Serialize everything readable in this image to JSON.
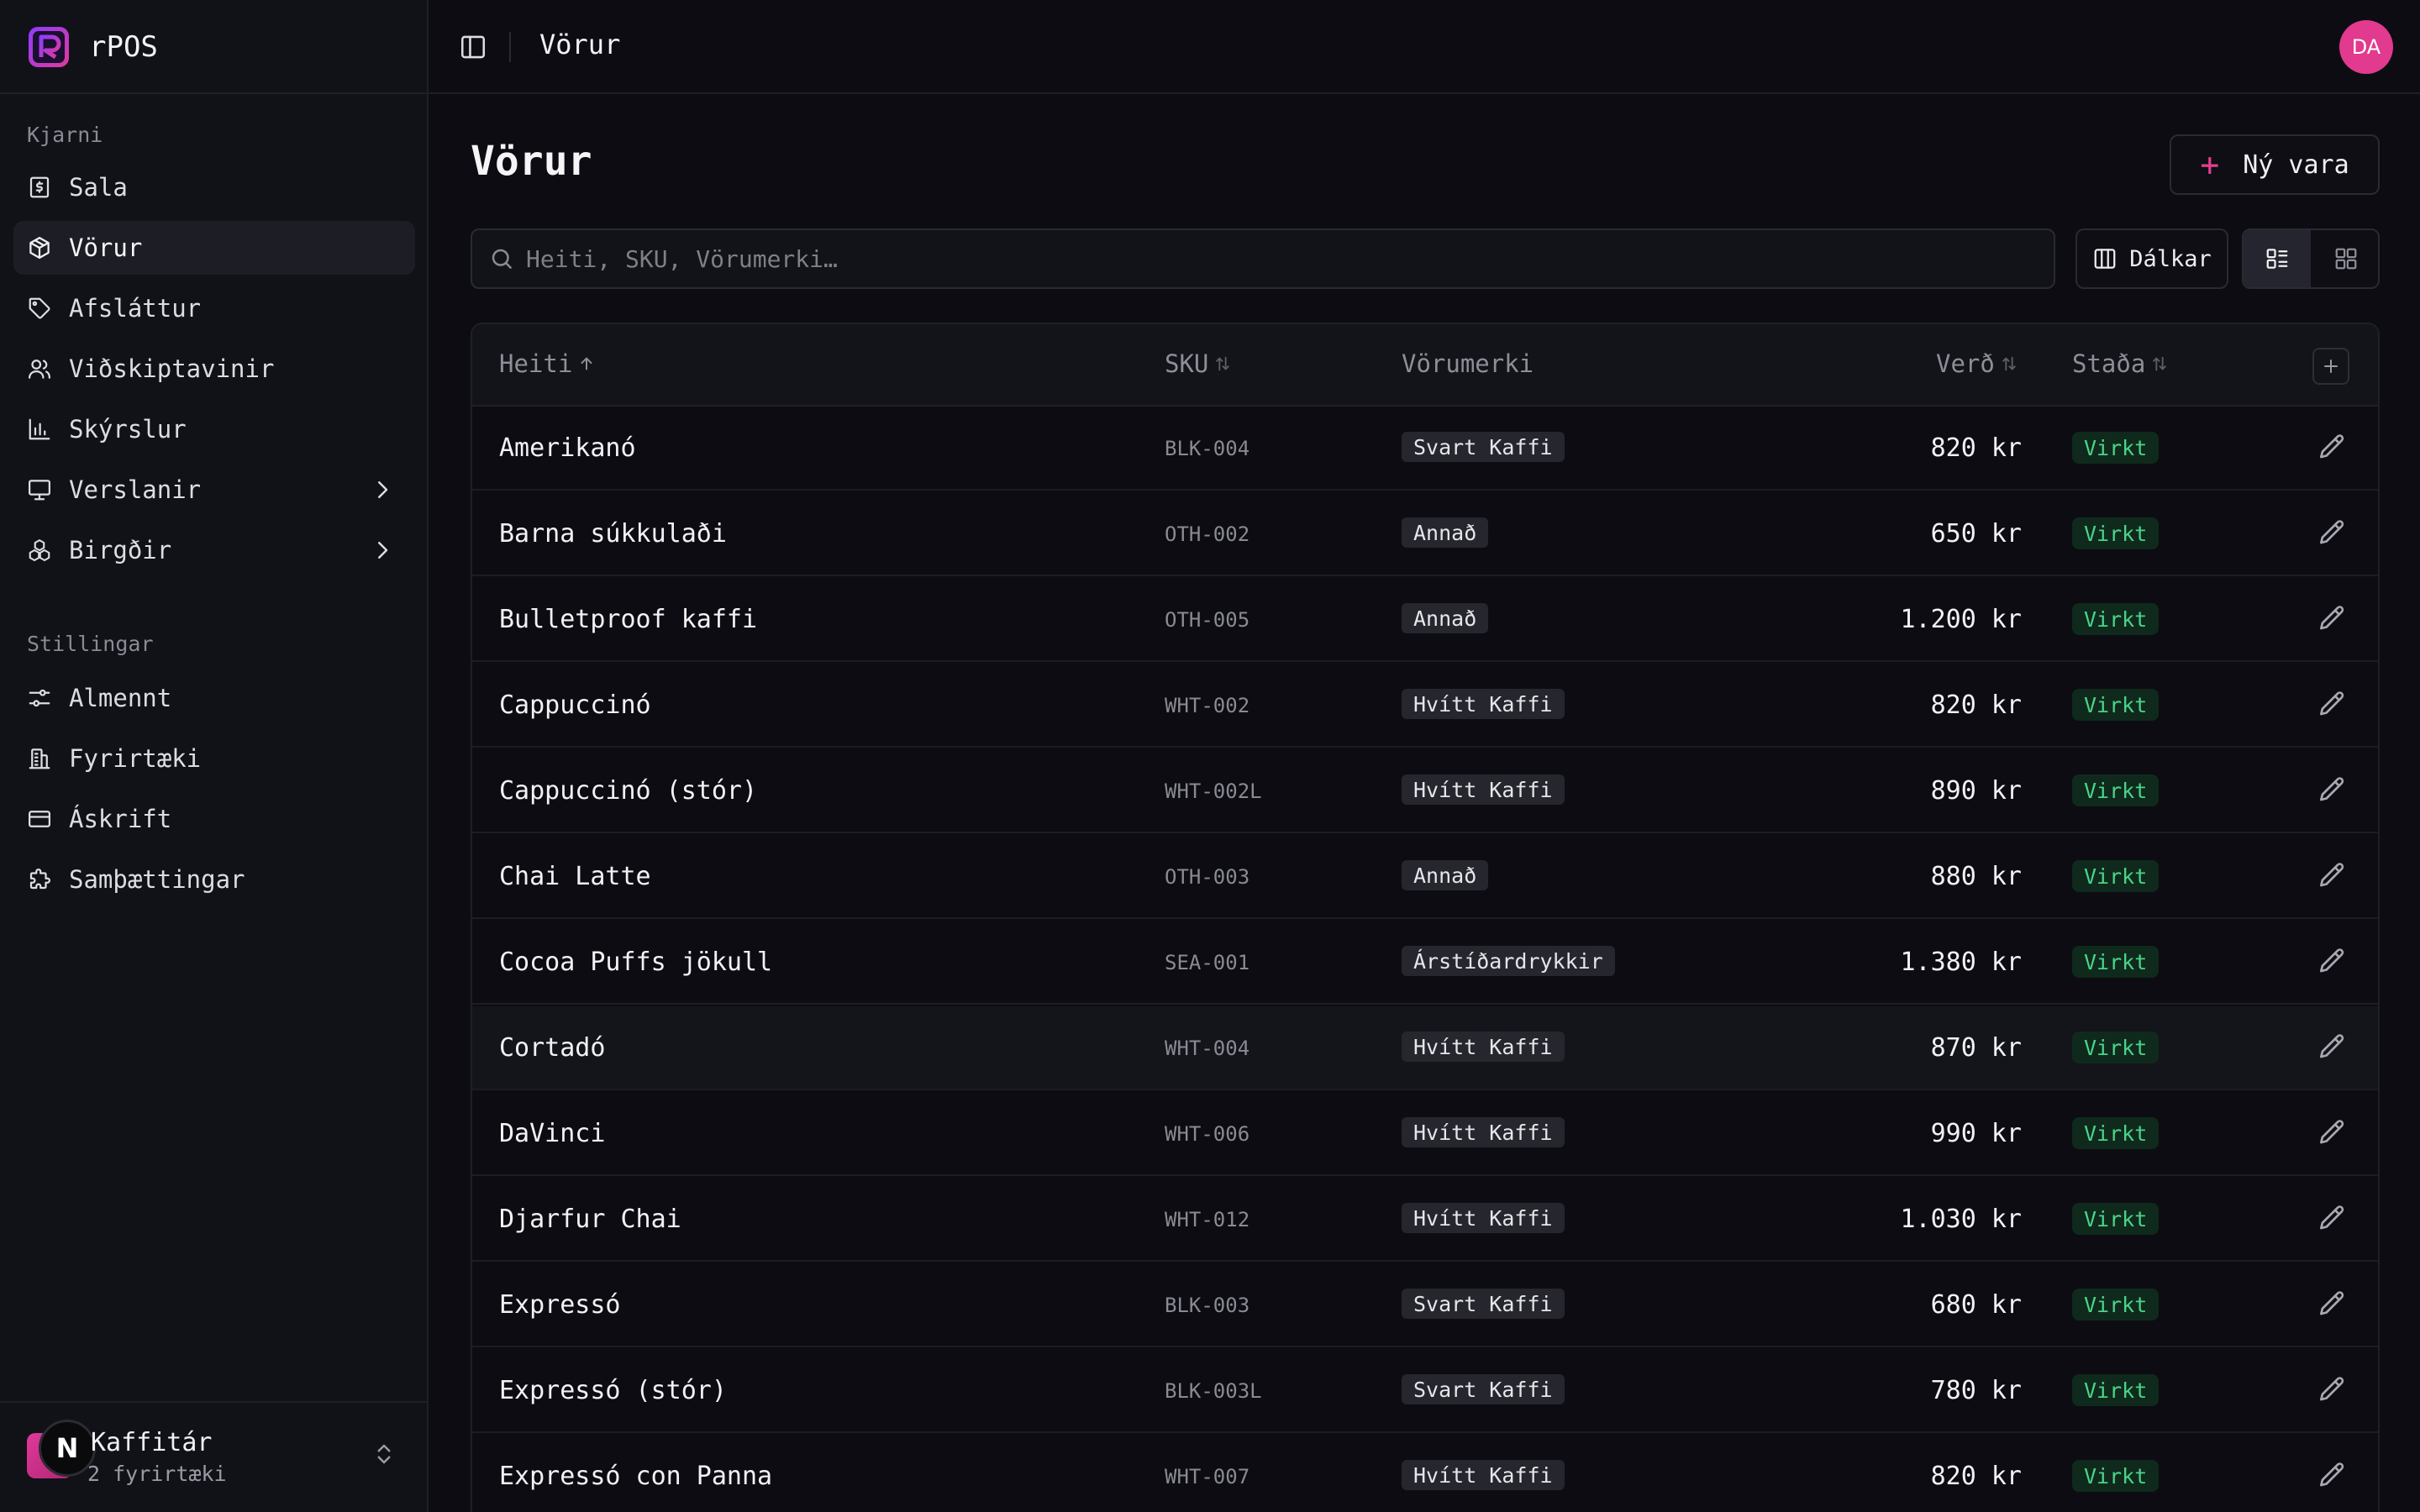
{
  "app": {
    "name": "rPOS",
    "accent": "#e13a8e"
  },
  "sidebar": {
    "section_core": "Kjarni",
    "core_items": [
      {
        "label": "Sala",
        "icon": "receipt-dollar-icon"
      },
      {
        "label": "Vörur",
        "icon": "package-icon",
        "active": true
      },
      {
        "label": "Afsláttur",
        "icon": "tag-icon"
      },
      {
        "label": "Viðskiptavinir",
        "icon": "users-icon"
      },
      {
        "label": "Skýrslur",
        "icon": "bar-chart-icon"
      },
      {
        "label": "Verslanir",
        "icon": "monitor-icon",
        "expandable": true
      },
      {
        "label": "Birgðir",
        "icon": "boxes-icon",
        "expandable": true
      }
    ],
    "section_settings": "Stillingar",
    "settings_items": [
      {
        "label": "Almennt",
        "icon": "sliders-icon"
      },
      {
        "label": "Fyrirtæki",
        "icon": "building-icon"
      },
      {
        "label": "Áskrift",
        "icon": "credit-card-icon"
      },
      {
        "label": "Samþættingar",
        "icon": "puzzle-icon"
      }
    ],
    "org": {
      "name": "Kaffitár",
      "sub": "2 fyrirtæki",
      "badge": "N"
    }
  },
  "topbar": {
    "title": "Vörur",
    "avatar_initials": "DA"
  },
  "main": {
    "title": "Vörur",
    "new_button": "Ný vara",
    "search_placeholder": "Heiti, SKU, Vörumerki…",
    "columns_button": "Dálkar"
  },
  "table": {
    "headers": {
      "name": "Heiti",
      "sku": "SKU",
      "brand": "Vörumerki",
      "price": "Verð",
      "status": "Staða"
    },
    "sort": {
      "column": "name",
      "direction": "asc"
    },
    "rows": [
      {
        "name": "Amerikanó",
        "sku": "BLK-004",
        "brand": "Svart Kaffi",
        "price": "820 kr",
        "status": "Virkt"
      },
      {
        "name": "Barna súkkulaði",
        "sku": "OTH-002",
        "brand": "Annað",
        "price": "650 kr",
        "status": "Virkt"
      },
      {
        "name": "Bulletproof kaffi",
        "sku": "OTH-005",
        "brand": "Annað",
        "price": "1.200 kr",
        "status": "Virkt"
      },
      {
        "name": "Cappuccinó",
        "sku": "WHT-002",
        "brand": "Hvítt Kaffi",
        "price": "820 kr",
        "status": "Virkt"
      },
      {
        "name": "Cappuccinó (stór)",
        "sku": "WHT-002L",
        "brand": "Hvítt Kaffi",
        "price": "890 kr",
        "status": "Virkt"
      },
      {
        "name": "Chai Latte",
        "sku": "OTH-003",
        "brand": "Annað",
        "price": "880 kr",
        "status": "Virkt"
      },
      {
        "name": "Cocoa Puffs jökull",
        "sku": "SEA-001",
        "brand": "Árstíðardrykkir",
        "price": "1.380 kr",
        "status": "Virkt"
      },
      {
        "name": "Cortadó",
        "sku": "WHT-004",
        "brand": "Hvítt Kaffi",
        "price": "870 kr",
        "status": "Virkt",
        "hovered": true
      },
      {
        "name": "DaVinci",
        "sku": "WHT-006",
        "brand": "Hvítt Kaffi",
        "price": "990 kr",
        "status": "Virkt"
      },
      {
        "name": "Djarfur Chai",
        "sku": "WHT-012",
        "brand": "Hvítt Kaffi",
        "price": "1.030 kr",
        "status": "Virkt"
      },
      {
        "name": "Expressó",
        "sku": "BLK-003",
        "brand": "Svart Kaffi",
        "price": "680 kr",
        "status": "Virkt"
      },
      {
        "name": "Expressó (stór)",
        "sku": "BLK-003L",
        "brand": "Svart Kaffi",
        "price": "780 kr",
        "status": "Virkt"
      },
      {
        "name": "Expressó con Panna",
        "sku": "WHT-007",
        "brand": "Hvítt Kaffi",
        "price": "820 kr",
        "status": "Virkt"
      }
    ]
  }
}
